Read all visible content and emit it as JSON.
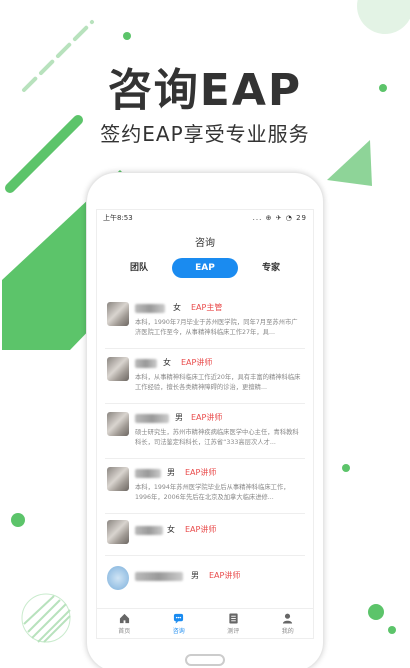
{
  "hero": {
    "title": "咨询EAP",
    "subtitle": "签约EAP享受专业服务"
  },
  "colors": {
    "accent": "#1a8bf0",
    "role_red": "#e94b4b",
    "deco_green": "#5cc46a"
  },
  "phone": {
    "status_time": "上午8:53",
    "status_icons": "... ⊕ ✈ ◔ 29",
    "nav_title": "咨询",
    "tabs": [
      {
        "label": "团队"
      },
      {
        "label": "EAP"
      },
      {
        "label": "专家"
      }
    ],
    "experts": [
      {
        "gender": "女",
        "role": "EAP主管",
        "desc": "本科，1990年7月毕业于苏州医学院，同年7月至苏州市广济医院工作至今，从事精神科临床工作27年，具..."
      },
      {
        "gender": "女",
        "role": "EAP讲师",
        "desc": "本科，从事精神科临床工作近20年，具有丰富的精神科临床工作经验，擅长各类精神障碍的诊治，更擅精..."
      },
      {
        "gender": "男",
        "role": "EAP讲师",
        "desc": "硕士研究生，苏州市精神疾病临床医学中心主任，青科教科科长，司法鉴定科科长，江苏省“333高层次人才..."
      },
      {
        "gender": "男",
        "role": "EAP讲师",
        "desc": "本科，1994年苏州医学院毕业后从事精神科临床工作，1996年，2006年先后在北京及加拿大临床进修..."
      },
      {
        "gender": "女",
        "role": "EAP讲师",
        "desc": ""
      },
      {
        "gender": "男",
        "role": "EAP讲师",
        "desc": ""
      }
    ],
    "bottom_nav": [
      {
        "label": "首页",
        "icon": "home-icon"
      },
      {
        "label": "咨询",
        "icon": "chat-icon"
      },
      {
        "label": "测评",
        "icon": "list-icon"
      },
      {
        "label": "我的",
        "icon": "user-icon"
      }
    ]
  }
}
